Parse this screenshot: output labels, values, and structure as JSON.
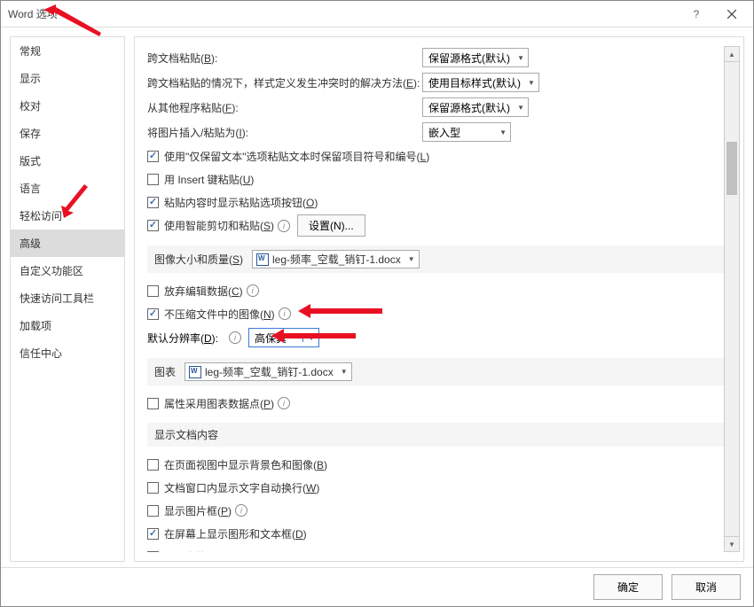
{
  "title": "Word 选项",
  "sidebar": [
    {
      "label": "常规"
    },
    {
      "label": "显示"
    },
    {
      "label": "校对"
    },
    {
      "label": "保存"
    },
    {
      "label": "版式"
    },
    {
      "label": "语言"
    },
    {
      "label": "轻松访问"
    },
    {
      "label": "高级",
      "selected": true
    },
    {
      "label": "自定义功能区"
    },
    {
      "label": "快速访问工具栏"
    },
    {
      "label": "加载项"
    },
    {
      "label": "信任中心"
    }
  ],
  "paste": {
    "cross_label_pre": "跨文档粘贴(",
    "cross_key": "B",
    "cross_label_post": "):",
    "cross_value": "保留源格式(默认)",
    "conflict_label_pre": "跨文档粘贴的情况下，样式定义发生冲突时的解决方法(",
    "conflict_key": "E",
    "conflict_label_post": "):",
    "conflict_value": "使用目标样式(默认)",
    "other_label_pre": "从其他程序粘贴(",
    "other_key": "F",
    "other_label_post": "):",
    "other_value": "保留源格式(默认)",
    "image_label_pre": "将图片插入/粘贴为(",
    "image_key": "I",
    "image_label_post": "):",
    "image_value": "嵌入型",
    "cb_keep_bullets_pre": "使用\"仅保留文本\"选项粘贴文本时保留项目符号和编号(",
    "cb_keep_bullets_key": "L",
    "cb_keep_bullets_post": ")",
    "cb_insert_pre": "用 Insert 键粘贴(",
    "cb_insert_key": "U",
    "cb_insert_post": ")",
    "cb_show_opts_pre": "粘贴内容时显示粘贴选项按钮(",
    "cb_show_opts_key": "O",
    "cb_show_opts_post": ")",
    "cb_smart_pre": "使用智能剪切和粘贴(",
    "cb_smart_key": "S",
    "cb_smart_post": ")",
    "settings_btn": "设置(N)..."
  },
  "image_quality": {
    "header_pre": "图像大小和质量(",
    "header_key": "S",
    "header_post": ")",
    "doc_name": "leg-频率_空载_销钉-1.docx",
    "cb_discard_pre": "放弃编辑数据(",
    "cb_discard_key": "C",
    "cb_discard_post": ")",
    "cb_nocompress_pre": "不压缩文件中的图像(",
    "cb_nocompress_key": "N",
    "cb_nocompress_post": ")",
    "res_label_pre": "默认分辨率(",
    "res_key": "D",
    "res_label_post": "):",
    "res_value": "高保真"
  },
  "chart": {
    "header": "图表",
    "doc_name": "leg-频率_空载_销钉-1.docx",
    "cb_props_pre": "属性采用图表数据点(",
    "cb_props_key": "P",
    "cb_props_post": ")"
  },
  "display": {
    "header": "显示文档内容",
    "cb_bg_pre": "在页面视图中显示背景色和图像(",
    "cb_bg_key": "B",
    "cb_bg_post": ")",
    "cb_wrap_pre": "文档窗口内显示文字自动换行(",
    "cb_wrap_key": "W",
    "cb_wrap_post": ")",
    "cb_placeholder_pre": "显示图片框(",
    "cb_placeholder_key": "P",
    "cb_placeholder_post": ")",
    "cb_drawings_pre": "在屏幕上显示图形和文本框(",
    "cb_drawings_key": "D",
    "cb_drawings_post": ")",
    "cb_bookmark_pre": "显示书签(",
    "cb_bookmark_key": "K",
    "cb_bookmark_post": ")"
  },
  "footer": {
    "ok": "确定",
    "cancel": "取消"
  }
}
